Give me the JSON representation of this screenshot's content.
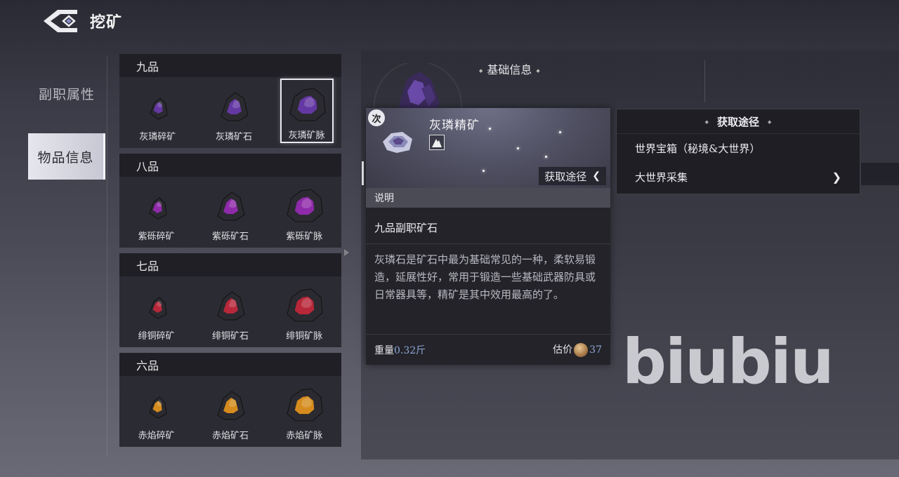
{
  "header": {
    "title": "挖矿"
  },
  "side_tabs": {
    "attributes": "副职属性",
    "item_info": "物品信息"
  },
  "grades": [
    {
      "label": "九品",
      "items": [
        {
          "name": "灰璘碎矿",
          "color": "#6a3ab0",
          "size": "small"
        },
        {
          "name": "灰璘矿石",
          "color": "#6a3ab0",
          "size": "medium"
        },
        {
          "name": "灰璘矿脉",
          "color": "#6a3ab0",
          "size": "large",
          "selected": true
        }
      ]
    },
    {
      "label": "八品",
      "items": [
        {
          "name": "紫砾碎矿",
          "color": "#9a2ab8",
          "size": "small"
        },
        {
          "name": "紫砾矿石",
          "color": "#9a2ab8",
          "size": "medium"
        },
        {
          "name": "紫砾矿脉",
          "color": "#9a2ab8",
          "size": "large"
        }
      ]
    },
    {
      "label": "七品",
      "items": [
        {
          "name": "绯铜碎矿",
          "color": "#c8283c",
          "size": "small"
        },
        {
          "name": "绯铜矿石",
          "color": "#c8283c",
          "size": "medium"
        },
        {
          "name": "绯铜矿脉",
          "color": "#c8283c",
          "size": "large"
        }
      ]
    },
    {
      "label": "六品",
      "items": [
        {
          "name": "赤焰碎矿",
          "color": "#e8961c",
          "size": "small"
        },
        {
          "name": "赤焰矿石",
          "color": "#e8961c",
          "size": "medium"
        },
        {
          "name": "赤焰矿脉",
          "color": "#e8961c",
          "size": "large"
        }
      ]
    }
  ],
  "detail": {
    "section_title": "基础信息",
    "badge": "次",
    "item_name": "灰璘精矿",
    "source_button": "获取途径",
    "desc_header": "说明",
    "item_type": "九品副职矿石",
    "description": "灰璘石是矿石中最为基础常见的一种，柔软易锻造，延展性好，常用于锻造一些基础武器防具或日常器具等，精矿是其中效用最高的了。",
    "weight_label": "重量",
    "weight_value": "0.32斤",
    "price_label": "估价",
    "price_value": "37"
  },
  "sources": {
    "title": "获取途径",
    "items": [
      {
        "label": "世界宝箱（秘境&大世界）",
        "has_arrow": false
      },
      {
        "label": "大世界采集",
        "has_arrow": true
      }
    ]
  },
  "watermark": "biubiu"
}
